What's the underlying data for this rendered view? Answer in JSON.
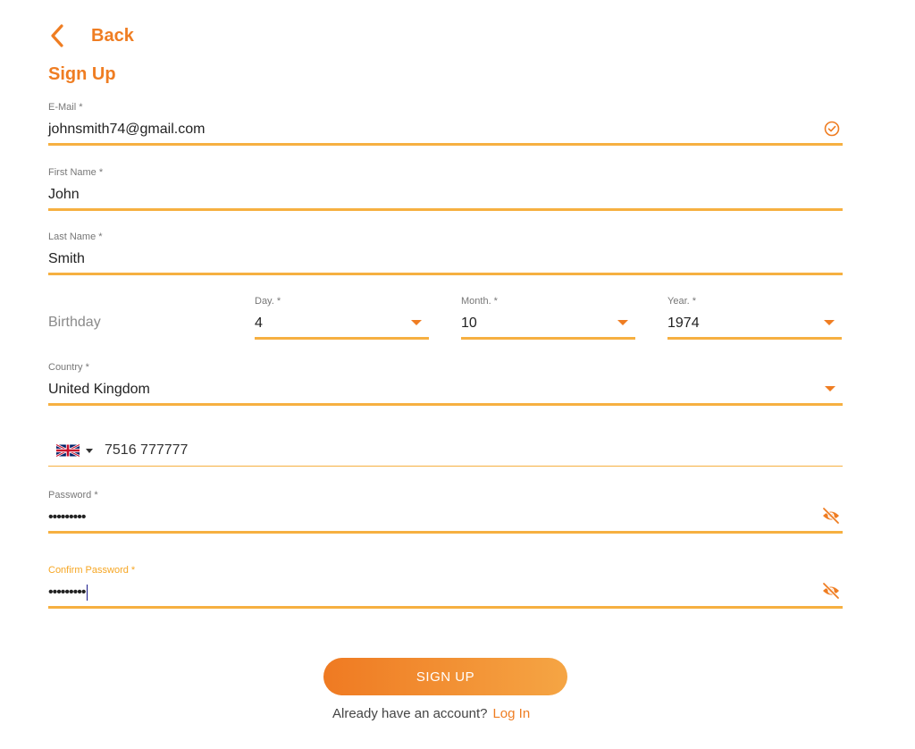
{
  "nav": {
    "back_label": "Back"
  },
  "page_title": "Sign Up",
  "form": {
    "email": {
      "label": "E-Mail *",
      "value": "johnsmith74@gmail.com",
      "status_icon": "check-circle-icon"
    },
    "first_name": {
      "label": "First Name *",
      "value": "John"
    },
    "last_name": {
      "label": "Last Name *",
      "value": "Smith"
    },
    "birthday": {
      "label": "Birthday",
      "day": {
        "label": "Day. *",
        "value": "4"
      },
      "month": {
        "label": "Month. *",
        "value": "10"
      },
      "year": {
        "label": "Year. *",
        "value": "1974"
      }
    },
    "country": {
      "label": "Country *",
      "value": "United Kingdom"
    },
    "phone": {
      "flag_icon": "uk-flag-icon",
      "value": "7516 777777"
    },
    "password": {
      "label": "Password *",
      "value": "•••••••••",
      "visibility_icon": "eye-off-icon"
    },
    "confirm_password": {
      "label": "Confirm Password *",
      "value": "•••••••••",
      "visibility_icon": "eye-off-icon"
    }
  },
  "actions": {
    "signup_label": "SIGN UP",
    "already_text": "Already have an account?",
    "login_label": "Log In"
  },
  "colors": {
    "accent": "#ef7d22",
    "underline": "#f6b041",
    "label_focus": "#f6a623"
  }
}
